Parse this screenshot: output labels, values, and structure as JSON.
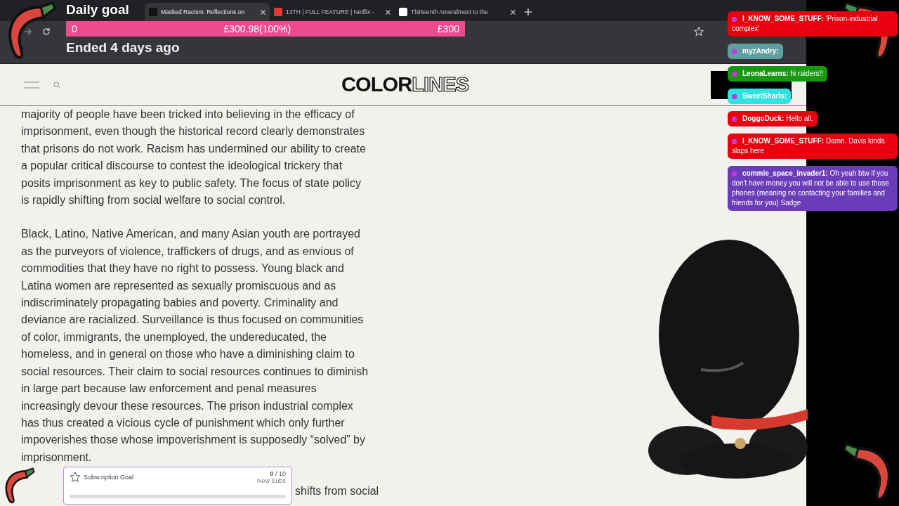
{
  "browser": {
    "tabs": [
      {
        "title": "Masked Racism: Reflections on",
        "selected": true
      },
      {
        "title": "13TH | FULL FEATURE | Netflix -",
        "selected": false
      },
      {
        "title": "Thirteenth Amendment to the",
        "selected": false
      }
    ]
  },
  "donation_goal": {
    "title": "Daily goal",
    "start": "0",
    "current": "£300.98(100%)",
    "target": "£300",
    "level": 1,
    "status": "Ended 4 days ago"
  },
  "site": {
    "logo_bold": "COLOR",
    "logo_light": "LINES"
  },
  "article": {
    "paragraphs": [
      [
        "majority of people have been tricked into believing in the efficacy of",
        "imprisonment, even though the historical record clearly demonstrates",
        "that prisons do not work. Racism has undermined our ability to create",
        "a popular critical discourse to contest the ideological trickery that",
        "posits imprisonment as key to public safety. The focus of state policy",
        "is rapidly shifting from social welfare to social control."
      ],
      [
        "Black, Latino, Native American, and many Asian youth are portrayed",
        "as the purveyors of violence, traffickers of drugs, and as envious of",
        "commodities that they have no right to possess. Young black and",
        "Latina women are represented as sexually promiscuous and as",
        "indiscriminately propagating babies and poverty. Criminality and",
        "deviance are racialized. Surveillance is thus focused on communities",
        "of color, immigrants, the unemployed, the undereducated, the",
        "homeless, and in general on those who have a diminishing claim to",
        "social resources. Their claim to social resources continues to diminish",
        "in large part because law enforcement and penal measures",
        "increasingly devour these resources. The prison industrial complex",
        "has thus created a vicious cycle of punishment which only further",
        "impoverishes those whose impoverishment is supposedly “solved” by",
        "imprisonment."
      ],
      [
        "shifts from social"
      ]
    ]
  },
  "chat": [
    {
      "user": "I_KNOW_SOME_STUFF:",
      "message": "'Prison-industrial complex'",
      "color": "#e8000f"
    },
    {
      "user": "myzAndry:",
      "color": "#5e9ea0"
    },
    {
      "user": "LeonaLearns:",
      "message": "hi raiders!!",
      "color": "#18980f"
    },
    {
      "user": "SweetSharts:",
      "color": "#2fe3e0"
    },
    {
      "user": "DoggoDuck:",
      "message": "Hello all.",
      "color": "#e8000f"
    },
    {
      "user": "I_KNOW_SOME_STUFF:",
      "message": "Damn. Davis kinda slaps here",
      "color": "#e8000f"
    },
    {
      "user": "commie_space_invader1:",
      "message": "Oh yeah btw if you don't have money you will not be able to use those phones (meaning no contacting your families and friends for you) Sadge",
      "color": "#6a3db8"
    }
  ],
  "subscription_goal": {
    "title": "Subscription Goal",
    "count": "**0** / 10",
    "unit": "New Subs",
    "level": 0
  }
}
